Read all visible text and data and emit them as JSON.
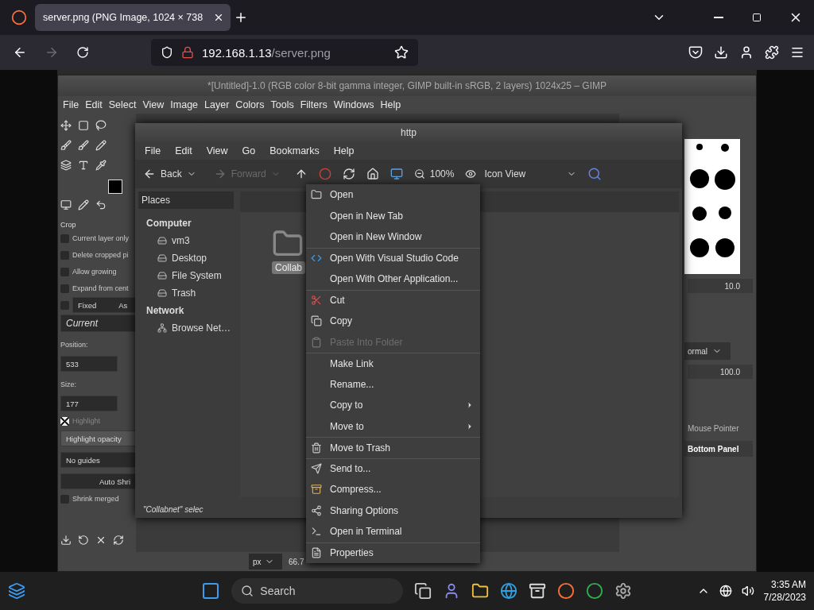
{
  "browser": {
    "tabs": [
      {
        "title": "server.png (PNG Image, 1024 × 738",
        "selected": true
      }
    ],
    "address": {
      "host": "192.168.1.13",
      "path": "/server.png"
    }
  },
  "gimp": {
    "title": "*[Untitled]-1.0 (RGB color 8-bit gamma integer, GIMP built-in sRGB, 2 layers) 1024x25 – GIMP",
    "menu": [
      "File",
      "Edit",
      "Select",
      "View",
      "Image",
      "Layer",
      "Colors",
      "Tools",
      "Filters",
      "Windows",
      "Help"
    ],
    "tool_options": {
      "title": "Crop",
      "options": [
        {
          "label": "Current layer only",
          "checked": false
        },
        {
          "label": "Delete cropped pi",
          "checked": false
        },
        {
          "label": "Allow growing",
          "checked": false
        },
        {
          "label": "Expand from cent",
          "checked": false
        }
      ],
      "fixed": {
        "checked": false,
        "label": "Fixed",
        "mode": "As"
      },
      "current": "Current",
      "position_label": "Position:",
      "position_value": "533",
      "size_label": "Size:",
      "size_value": "177",
      "highlight": {
        "label": "Highlight",
        "checked": true
      },
      "highlight_opacity": "Highlight opacity",
      "guides": "No guides",
      "auto_shrink": "Auto Shri",
      "shrink_merged": {
        "label": "Shrink merged",
        "checked": false
      }
    },
    "dock": {
      "brush_size": "10.0",
      "mode": "ormal",
      "opacity": "100.0",
      "devices": [
        {
          "label": "Mouse Pointer",
          "selected": false
        },
        {
          "label": "Bottom Panel",
          "selected": true
        }
      ]
    },
    "status": {
      "unit": "px",
      "zoom": "66.7"
    }
  },
  "file_manager": {
    "title": "http",
    "menu": [
      "File",
      "Edit",
      "View",
      "Go",
      "Bookmarks",
      "Help"
    ],
    "toolbar": {
      "back": {
        "label": "Back",
        "disabled": false
      },
      "forward": {
        "label": "Forward",
        "disabled": true
      },
      "zoom": "100%",
      "view": "Icon View"
    },
    "sidebar": {
      "title": "Places",
      "sections": [
        {
          "title": "Computer",
          "items": [
            "vm3",
            "Desktop",
            "File System",
            "Trash"
          ]
        },
        {
          "title": "Network",
          "items": [
            "Browse Net…"
          ]
        }
      ]
    },
    "folder": {
      "label": "Collab"
    },
    "status": "\"Collabnet\" selec"
  },
  "context_menu": [
    {
      "label": "Open",
      "disabled": false,
      "submenu": false,
      "separator_before": false
    },
    {
      "label": "Open in New Tab",
      "disabled": false,
      "submenu": false,
      "separator_before": false
    },
    {
      "label": "Open in New Window",
      "disabled": false,
      "submenu": false,
      "separator_before": false
    },
    {
      "label": "Open With Visual Studio Code",
      "disabled": false,
      "submenu": false,
      "separator_before": true
    },
    {
      "label": "Open With Other Application...",
      "disabled": false,
      "submenu": false,
      "separator_before": false
    },
    {
      "label": "Cut",
      "disabled": false,
      "submenu": false,
      "separator_before": true
    },
    {
      "label": "Copy",
      "disabled": false,
      "submenu": false,
      "separator_before": false
    },
    {
      "label": "Paste Into Folder",
      "disabled": true,
      "submenu": false,
      "separator_before": false
    },
    {
      "label": "Make Link",
      "disabled": false,
      "submenu": false,
      "separator_before": true
    },
    {
      "label": "Rename...",
      "disabled": false,
      "submenu": false,
      "separator_before": false
    },
    {
      "label": "Copy to",
      "disabled": false,
      "submenu": true,
      "separator_before": false
    },
    {
      "label": "Move to",
      "disabled": false,
      "submenu": true,
      "separator_before": false
    },
    {
      "label": "Move to Trash",
      "disabled": false,
      "submenu": false,
      "separator_before": true
    },
    {
      "label": "Send to...",
      "disabled": false,
      "submenu": false,
      "separator_before": true
    },
    {
      "label": "Compress...",
      "disabled": false,
      "submenu": false,
      "separator_before": false
    },
    {
      "label": "Sharing Options",
      "disabled": false,
      "submenu": false,
      "separator_before": false
    },
    {
      "label": "Open in Terminal",
      "disabled": false,
      "submenu": false,
      "separator_before": false
    },
    {
      "label": "Properties",
      "disabled": false,
      "submenu": false,
      "separator_before": true
    }
  ],
  "taskbar": {
    "search": {
      "placeholder": "Search"
    },
    "time": "3:35 AM",
    "date": "7/28/2023"
  }
}
